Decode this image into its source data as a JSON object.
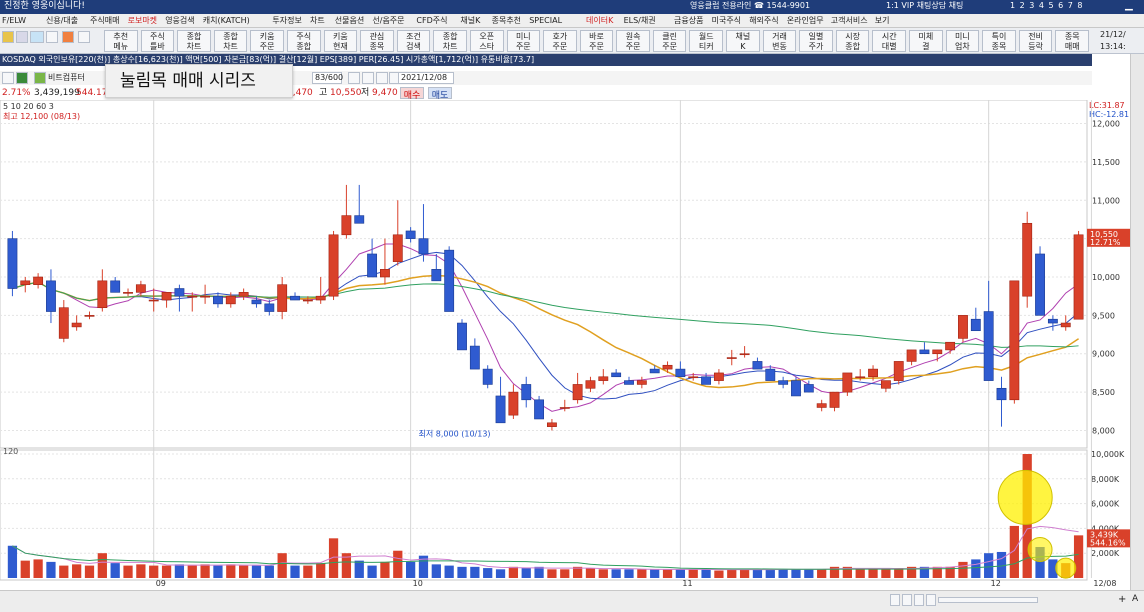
{
  "titlebar": {
    "text": "진정한 영웅이십니다!",
    "center": "영웅클럽 전용라인 ☎ 1544-9901",
    "vip": "1:1 VIP 채팅상담 채팅",
    "numbers": "1 2 3 4 5 6 7 8"
  },
  "menu": [
    "F/ELW",
    "신용/대출",
    "주식매매",
    "로보마켓",
    "영웅검색",
    "캐치(KATCH)",
    "투자정보",
    "차트",
    "선물옵션",
    "선/옵주문",
    "CFD주식",
    "채널K",
    "종목추천",
    "SPECIAL",
    "데이터K",
    "ELS/채권",
    "금융상품",
    "미국주식",
    "해외주식",
    "온라인업무",
    "고객서비스",
    "보기"
  ],
  "menu_highlight": [
    "로보마켓",
    "데이터K"
  ],
  "toolbar_buttons": [
    "추천 메뉴",
    "주식 틀바",
    "종합 차트",
    "종합 차트",
    "키움 주문",
    "주식 종합",
    "키움 현재",
    "관심 종목",
    "조건 검색",
    "종합 차트",
    "오픈 스타",
    "미니 주문",
    "호가 주문",
    "바로 주문",
    "원속 주문",
    "클린 주문",
    "월드 티커",
    "채널 K",
    "거래 변동",
    "일별 주가",
    "시장 종합",
    "시간 대별",
    "미체 결",
    "미니 업차",
    "특이 종목",
    "전비 등락",
    "종목 매매"
  ],
  "clock": {
    "date": "21/12/",
    "time": "13:14:"
  },
  "infobar": "KOSDAQ 외국인보유[220(천)] 총상수[16,623(천)] 액면[500] 자본금[83(억)] 결산[12월] EPS[389] PER[26.45] 시가총액[1,712(억)] 유통비율[73.7]",
  "ctrlbar": {
    "stock_name": "비트컴퓨터",
    "page": "83/600",
    "date": "2021/12/08"
  },
  "pricebar": {
    "change_pct": "2.71%",
    "volume": "3,439,199",
    "ratio": "544.17%",
    "lo_label": "9,470",
    "hi_label": "고",
    "hi": "10,550",
    "lo2_label": "저",
    "lo2": "9,470",
    "buy": "매수",
    "sell": "매도"
  },
  "overlay_title": "눌림목 매매 시리즈",
  "ma_legend": {
    "label": "5 10 20 60 3",
    "max": "최고 12,100 (08/13)"
  },
  "chart_data": {
    "type": "candlestick",
    "title": "눌림목 매매 시리즈",
    "price_axis": {
      "ticks": [
        8000,
        8500,
        9000,
        9500,
        10000,
        10500,
        11000,
        11500,
        12000
      ],
      "ylim": [
        7850,
        12150
      ],
      "right_top": "LC:31.87 HC:-12.81"
    },
    "volume_axis": {
      "ticks": [
        "2,000K",
        "4,000K",
        "6,000K",
        "8,000K",
        "10,000K"
      ],
      "ylim": [
        0,
        10000
      ],
      "top_label": "120"
    },
    "x_labels": [
      {
        "index": 11,
        "label": "09"
      },
      {
        "index": 31,
        "label": "10"
      },
      {
        "index": 52,
        "label": "11"
      },
      {
        "index": 76,
        "label": "12"
      },
      {
        "index": 84,
        "label": "12/08"
      }
    ],
    "last_price": {
      "value": 10550,
      "label": "10,550",
      "pct": "12.71%"
    },
    "last_volume": {
      "label": "3,439K",
      "pct": "544.16%"
    },
    "min_annotation": {
      "label": "최저 8,000 (10/13)",
      "index": 38,
      "value": 8000
    },
    "candles": [
      [
        10500,
        10600,
        9750,
        9850
      ],
      [
        9900,
        10000,
        9800,
        9950
      ],
      [
        9900,
        10050,
        9850,
        10000
      ],
      [
        9950,
        10100,
        9400,
        9550
      ],
      [
        9200,
        9700,
        9150,
        9600
      ],
      [
        9350,
        9500,
        9300,
        9400
      ],
      [
        9500,
        9550,
        9450,
        9500
      ],
      [
        9600,
        10100,
        9550,
        9950
      ],
      [
        9950,
        10000,
        9800,
        9800
      ],
      [
        9800,
        9850,
        9750,
        9800
      ],
      [
        9800,
        9950,
        9750,
        9900
      ],
      [
        9700,
        9850,
        9550,
        9700
      ],
      [
        9700,
        9750,
        9600,
        9800
      ],
      [
        9850,
        9900,
        9550,
        9750
      ],
      [
        9750,
        9800,
        9550,
        9750
      ],
      [
        9750,
        9900,
        9650,
        9750
      ],
      [
        9750,
        9800,
        9600,
        9650
      ],
      [
        9650,
        9800,
        9600,
        9750
      ],
      [
        9750,
        9850,
        9700,
        9800
      ],
      [
        9700,
        9750,
        9600,
        9650
      ],
      [
        9650,
        9700,
        9500,
        9550
      ],
      [
        9550,
        10000,
        9450,
        9900
      ],
      [
        9750,
        9800,
        9700,
        9700
      ],
      [
        9700,
        9750,
        9650,
        9700
      ],
      [
        9700,
        10000,
        9650,
        9750
      ],
      [
        9750,
        10600,
        9700,
        10550
      ],
      [
        10550,
        11200,
        10500,
        10800
      ],
      [
        10800,
        11200,
        10700,
        10700
      ],
      [
        10300,
        10500,
        10100,
        10000
      ],
      [
        10000,
        10500,
        9900,
        10100
      ],
      [
        10200,
        11000,
        10150,
        10550
      ],
      [
        10600,
        10650,
        10450,
        10500
      ],
      [
        10500,
        10950,
        10200,
        10300
      ],
      [
        10100,
        10300,
        9950,
        9950
      ],
      [
        10350,
        10400,
        9850,
        9550
      ],
      [
        9400,
        9450,
        9150,
        9050
      ],
      [
        9100,
        9200,
        8950,
        8800
      ],
      [
        8800,
        8850,
        8550,
        8600
      ],
      [
        8450,
        8700,
        8350,
        8100
      ],
      [
        8200,
        8600,
        8150,
        8500
      ],
      [
        8600,
        8700,
        8300,
        8400
      ],
      [
        8400,
        8450,
        8150,
        8150
      ],
      [
        8050,
        8150,
        8000,
        8100
      ],
      [
        8300,
        8400,
        8250,
        8300
      ],
      [
        8400,
        8750,
        8350,
        8600
      ],
      [
        8550,
        8700,
        8500,
        8650
      ],
      [
        8650,
        8800,
        8600,
        8700
      ],
      [
        8750,
        8800,
        8700,
        8700
      ],
      [
        8650,
        8700,
        8600,
        8600
      ],
      [
        8600,
        8700,
        8550,
        8650
      ],
      [
        8800,
        8850,
        8750,
        8750
      ],
      [
        8800,
        8900,
        8750,
        8850
      ],
      [
        8800,
        8900,
        8700,
        8700
      ],
      [
        8700,
        8750,
        8650,
        8700
      ],
      [
        8700,
        8750,
        8600,
        8600
      ],
      [
        8650,
        8800,
        8600,
        8750
      ],
      [
        8950,
        9050,
        8850,
        8950
      ],
      [
        9000,
        9100,
        8950,
        9000
      ],
      [
        8900,
        8950,
        8800,
        8800
      ],
      [
        8800,
        8850,
        8700,
        8650
      ],
      [
        8650,
        8700,
        8550,
        8600
      ],
      [
        8650,
        8700,
        8550,
        8450
      ],
      [
        8600,
        8650,
        8500,
        8500
      ],
      [
        8300,
        8400,
        8250,
        8350
      ],
      [
        8300,
        8500,
        8250,
        8500
      ],
      [
        8500,
        8700,
        8450,
        8750
      ],
      [
        8700,
        8800,
        8650,
        8700
      ],
      [
        8700,
        8850,
        8650,
        8800
      ],
      [
        8550,
        8600,
        8500,
        8650
      ],
      [
        8650,
        8900,
        8600,
        8900
      ],
      [
        8900,
        9050,
        8850,
        9050
      ],
      [
        9050,
        9150,
        9000,
        9000
      ],
      [
        9000,
        9050,
        8900,
        9050
      ],
      [
        9050,
        9150,
        9000,
        9150
      ],
      [
        9200,
        9500,
        9150,
        9500
      ],
      [
        9450,
        9600,
        9300,
        9300
      ],
      [
        9550,
        9950,
        8800,
        8650
      ],
      [
        8550,
        8700,
        8050,
        8400
      ],
      [
        8400,
        9900,
        8350,
        9950
      ],
      [
        9750,
        10850,
        9600,
        10700
      ],
      [
        10300,
        10400,
        9800,
        9500
      ],
      [
        9450,
        9500,
        9300,
        9400
      ],
      [
        9350,
        9500,
        9300,
        9400
      ],
      [
        9450,
        10600,
        9450,
        10550
      ]
    ],
    "volume": [
      2600,
      1400,
      1500,
      1300,
      1000,
      1100,
      1000,
      2000,
      1200,
      1000,
      1100,
      1000,
      1000,
      1100,
      1000,
      1100,
      1000,
      1100,
      1000,
      1000,
      1000,
      2000,
      1000,
      1000,
      1200,
      3200,
      2000,
      1400,
      1000,
      1300,
      2200,
      1300,
      1800,
      1100,
      1000,
      900,
      900,
      800,
      700,
      900,
      800,
      900,
      700,
      700,
      900,
      800,
      700,
      700,
      700,
      700,
      700,
      700,
      700,
      700,
      700,
      600,
      700,
      700,
      700,
      700,
      700,
      700,
      700,
      700,
      900,
      900,
      700,
      700,
      700,
      800,
      900,
      900,
      900,
      900,
      1300,
      1500,
      2000,
      2100,
      4200,
      10000,
      2500,
      1500,
      1200,
      3439
    ]
  }
}
